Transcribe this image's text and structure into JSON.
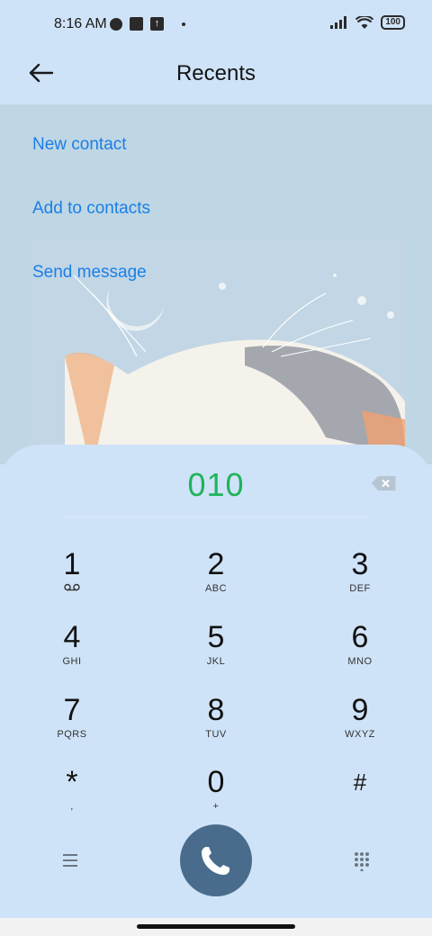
{
  "status_bar": {
    "time": "8:16 AM",
    "battery": "100"
  },
  "header": {
    "title": "Recents"
  },
  "options": [
    {
      "label": "New contact"
    },
    {
      "label": "Add to contacts"
    },
    {
      "label": "Send message"
    }
  ],
  "dialer": {
    "number": "010",
    "keys": [
      {
        "digit": "1",
        "letters": ""
      },
      {
        "digit": "2",
        "letters": "ABC"
      },
      {
        "digit": "3",
        "letters": "DEF"
      },
      {
        "digit": "4",
        "letters": "GHI"
      },
      {
        "digit": "5",
        "letters": "JKL"
      },
      {
        "digit": "6",
        "letters": "MNO"
      },
      {
        "digit": "7",
        "letters": "PQRS"
      },
      {
        "digit": "8",
        "letters": "TUV"
      },
      {
        "digit": "9",
        "letters": "WXYZ"
      },
      {
        "digit": "*",
        "letters": ","
      },
      {
        "digit": "0",
        "letters": "+"
      },
      {
        "digit": "#",
        "letters": ""
      }
    ]
  },
  "icons": {
    "back": "arrow-left-icon",
    "backspace": "backspace-icon",
    "call": "phone-icon",
    "menu": "menu-icon",
    "keypad": "dialpad-icon",
    "voicemail": "voicemail-icon"
  },
  "colors": {
    "accent": "#1a7fe6",
    "number": "#1fb45a",
    "call_button": "#4a6c8c"
  }
}
